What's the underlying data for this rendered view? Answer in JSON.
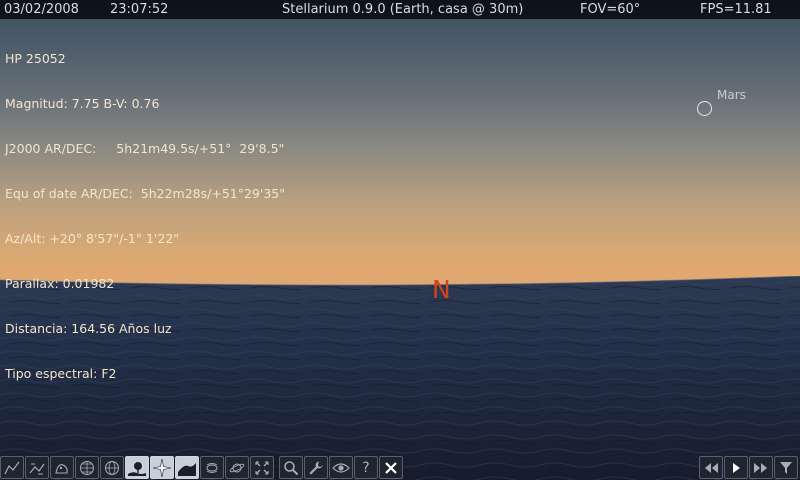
{
  "status_bar": {
    "date": "03/02/2008",
    "time": "23:07:52",
    "title": "Stellarium 0.9.0 (Earth, casa @ 30m)",
    "fov": "FOV=60°",
    "fps": "FPS=11.81"
  },
  "object_info": {
    "name": "HP 25052",
    "magnitude": "Magnitud: 7.75 B-V: 0.76",
    "j2000": "J2000 AR/DEC:     5h21m49.5s/+51°  29'8.5\"",
    "equ_of_date": "Equ of date AR/DEC:  5h22m28s/+51°29'35\"",
    "az_alt": "Az/Alt: +20° 8'57\"/-1° 1'22\"",
    "parallax": "Parallax: 0.01982",
    "distance": "Distancia: 164.56 Años luz",
    "spectral_type": "Tipo espectral: F2"
  },
  "sky": {
    "planet_label": "Mars",
    "cardinal_north": "N"
  },
  "colors": {
    "cardinal": "#d6421e",
    "info_text": "#f2e6cf",
    "sky_top": "#3e4f60",
    "horizon_glow": "#e1a86f",
    "ocean": "#1d2438"
  },
  "toolbar_left": [
    {
      "icon": "constellation-lines-icon",
      "active": false
    },
    {
      "icon": "constellation-labels-icon",
      "active": false
    },
    {
      "icon": "constellation-art-icon",
      "active": false
    },
    {
      "icon": "equatorial-grid-icon",
      "active": false
    },
    {
      "icon": "azimuthal-grid-icon",
      "active": false
    },
    {
      "icon": "ground-icon",
      "active": true
    },
    {
      "icon": "cardinal-points-icon",
      "active": true
    },
    {
      "icon": "atmosphere-icon",
      "active": true
    },
    {
      "icon": "nebulae-icon",
      "active": false
    },
    {
      "icon": "planet-labels-icon",
      "active": false
    },
    {
      "icon": "equatorial-mount-icon",
      "active": false
    },
    {
      "icon": "search-icon",
      "active": false
    },
    {
      "icon": "config-wrench-icon",
      "active": false
    },
    {
      "icon": "night-mode-eye-icon",
      "active": false
    },
    {
      "icon": "help-icon",
      "active": false
    },
    {
      "icon": "quit-icon",
      "active": false
    }
  ],
  "toolbar_right": [
    {
      "icon": "rewind-icon",
      "active": false
    },
    {
      "icon": "play-icon",
      "active": false
    },
    {
      "icon": "fast-forward-icon",
      "active": false
    },
    {
      "icon": "funnel-icon",
      "active": false
    }
  ]
}
